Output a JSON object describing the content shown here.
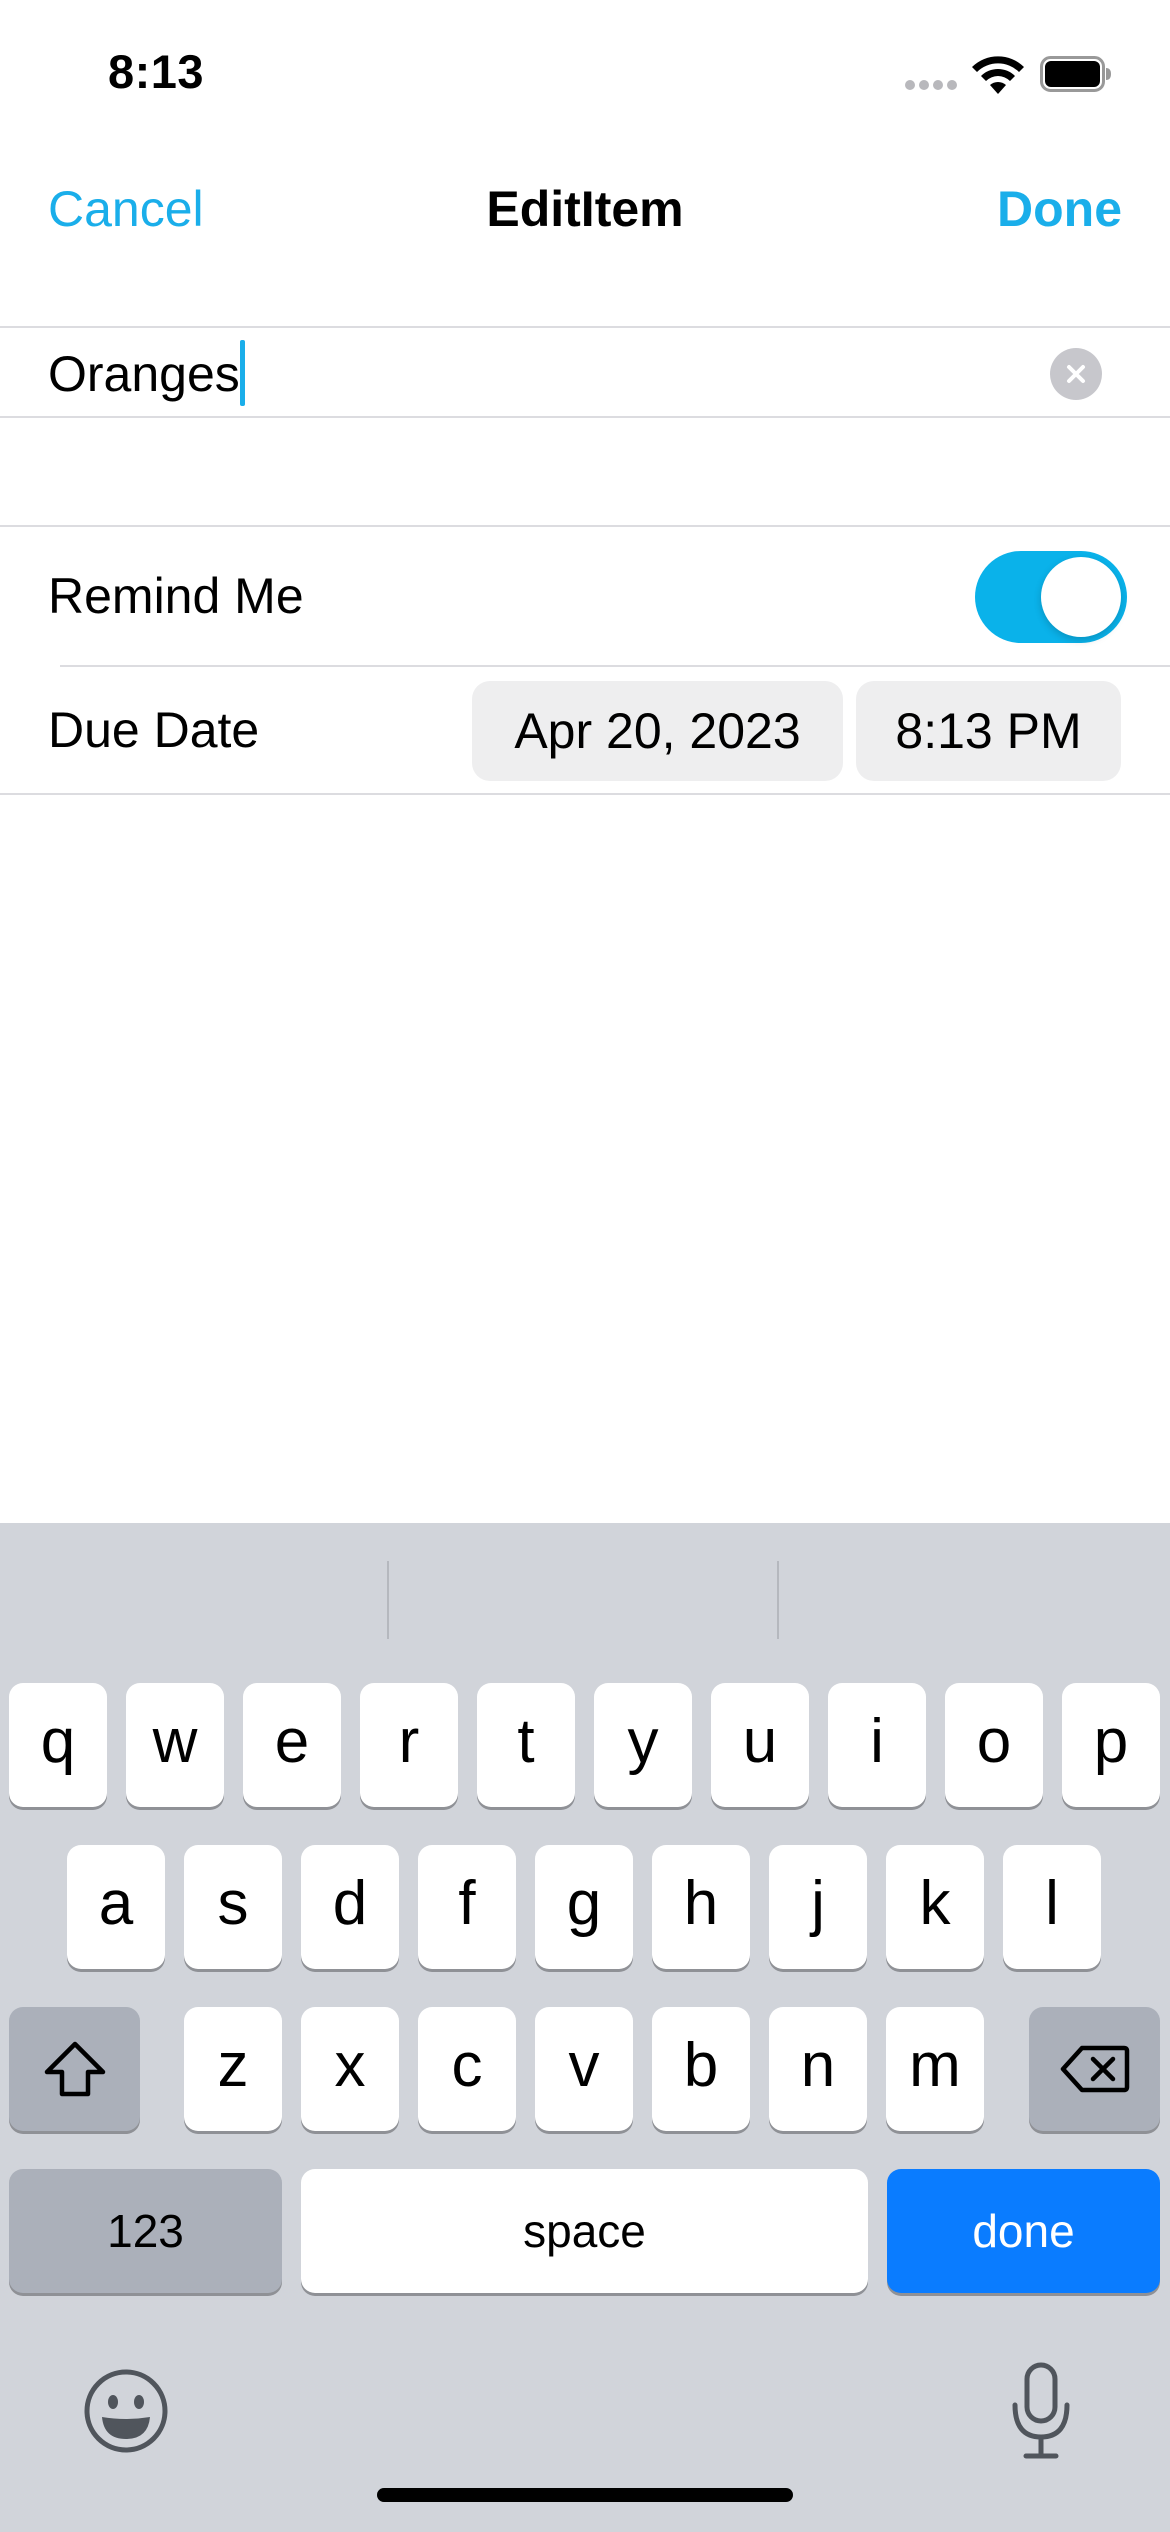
{
  "status_bar": {
    "time": "8:13"
  },
  "nav": {
    "cancel": "Cancel",
    "title": "EditItem",
    "done": "Done"
  },
  "form": {
    "name_value": "Oranges",
    "remind_label": "Remind Me",
    "remind_on": true,
    "due_label": "Due Date",
    "due_date": "Apr 20, 2023",
    "due_time": "8:13 PM"
  },
  "keyboard": {
    "row1": [
      "q",
      "w",
      "e",
      "r",
      "t",
      "y",
      "u",
      "i",
      "o",
      "p"
    ],
    "row2": [
      "a",
      "s",
      "d",
      "f",
      "g",
      "h",
      "j",
      "k",
      "l"
    ],
    "row3": [
      "z",
      "x",
      "c",
      "v",
      "b",
      "n",
      "m"
    ],
    "numbers_label": "123",
    "space_label": "space",
    "done_label": "done"
  },
  "colors": {
    "accent": "#1aaeea",
    "toggle": "#0ab2ea",
    "keyboard_done": "#0a7cff",
    "keyboard_bg": "#d1d4da"
  }
}
